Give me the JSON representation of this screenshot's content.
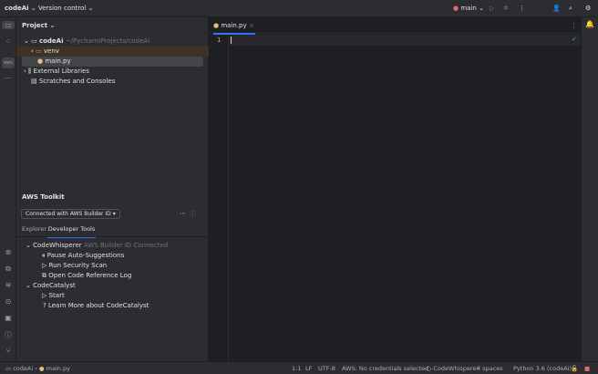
{
  "topbar": {
    "project": "codeAi",
    "vcs": "Version control",
    "branch": "main"
  },
  "project_panel": {
    "title": "Project",
    "tree": [
      {
        "label": "codeAi",
        "path": "~/PycharmProjects/codeAi"
      },
      {
        "label": "venv"
      },
      {
        "label": "main.py"
      },
      {
        "label": "External Libraries"
      },
      {
        "label": "Scratches and Consoles"
      }
    ]
  },
  "aws": {
    "title": "AWS Toolkit",
    "connection": "Connected with AWS Builder ID",
    "tabs": [
      "Explorer",
      "Developer Tools"
    ],
    "tree": [
      {
        "label": "CodeWhisperer",
        "note": "AWS Builder ID Connected"
      },
      {
        "label": "Pause Auto-Suggestions"
      },
      {
        "label": "Run Security Scan"
      },
      {
        "label": "Open Code Reference Log"
      },
      {
        "label": "CodeCatalyst"
      },
      {
        "label": "Start"
      },
      {
        "label": "Learn More about CodeCatalyst"
      }
    ]
  },
  "editor": {
    "tab": "main.py",
    "line": "1"
  },
  "status": {
    "breadcrumb": [
      "codeAi",
      "main.py"
    ],
    "pos": "1:1",
    "eol": "LF",
    "enc": "UTF-8",
    "aws": "AWS: No credentials selected",
    "cw": "CodeWhisperer",
    "indent": "4 spaces",
    "interp": "Python 3.6 (codeAi)"
  }
}
